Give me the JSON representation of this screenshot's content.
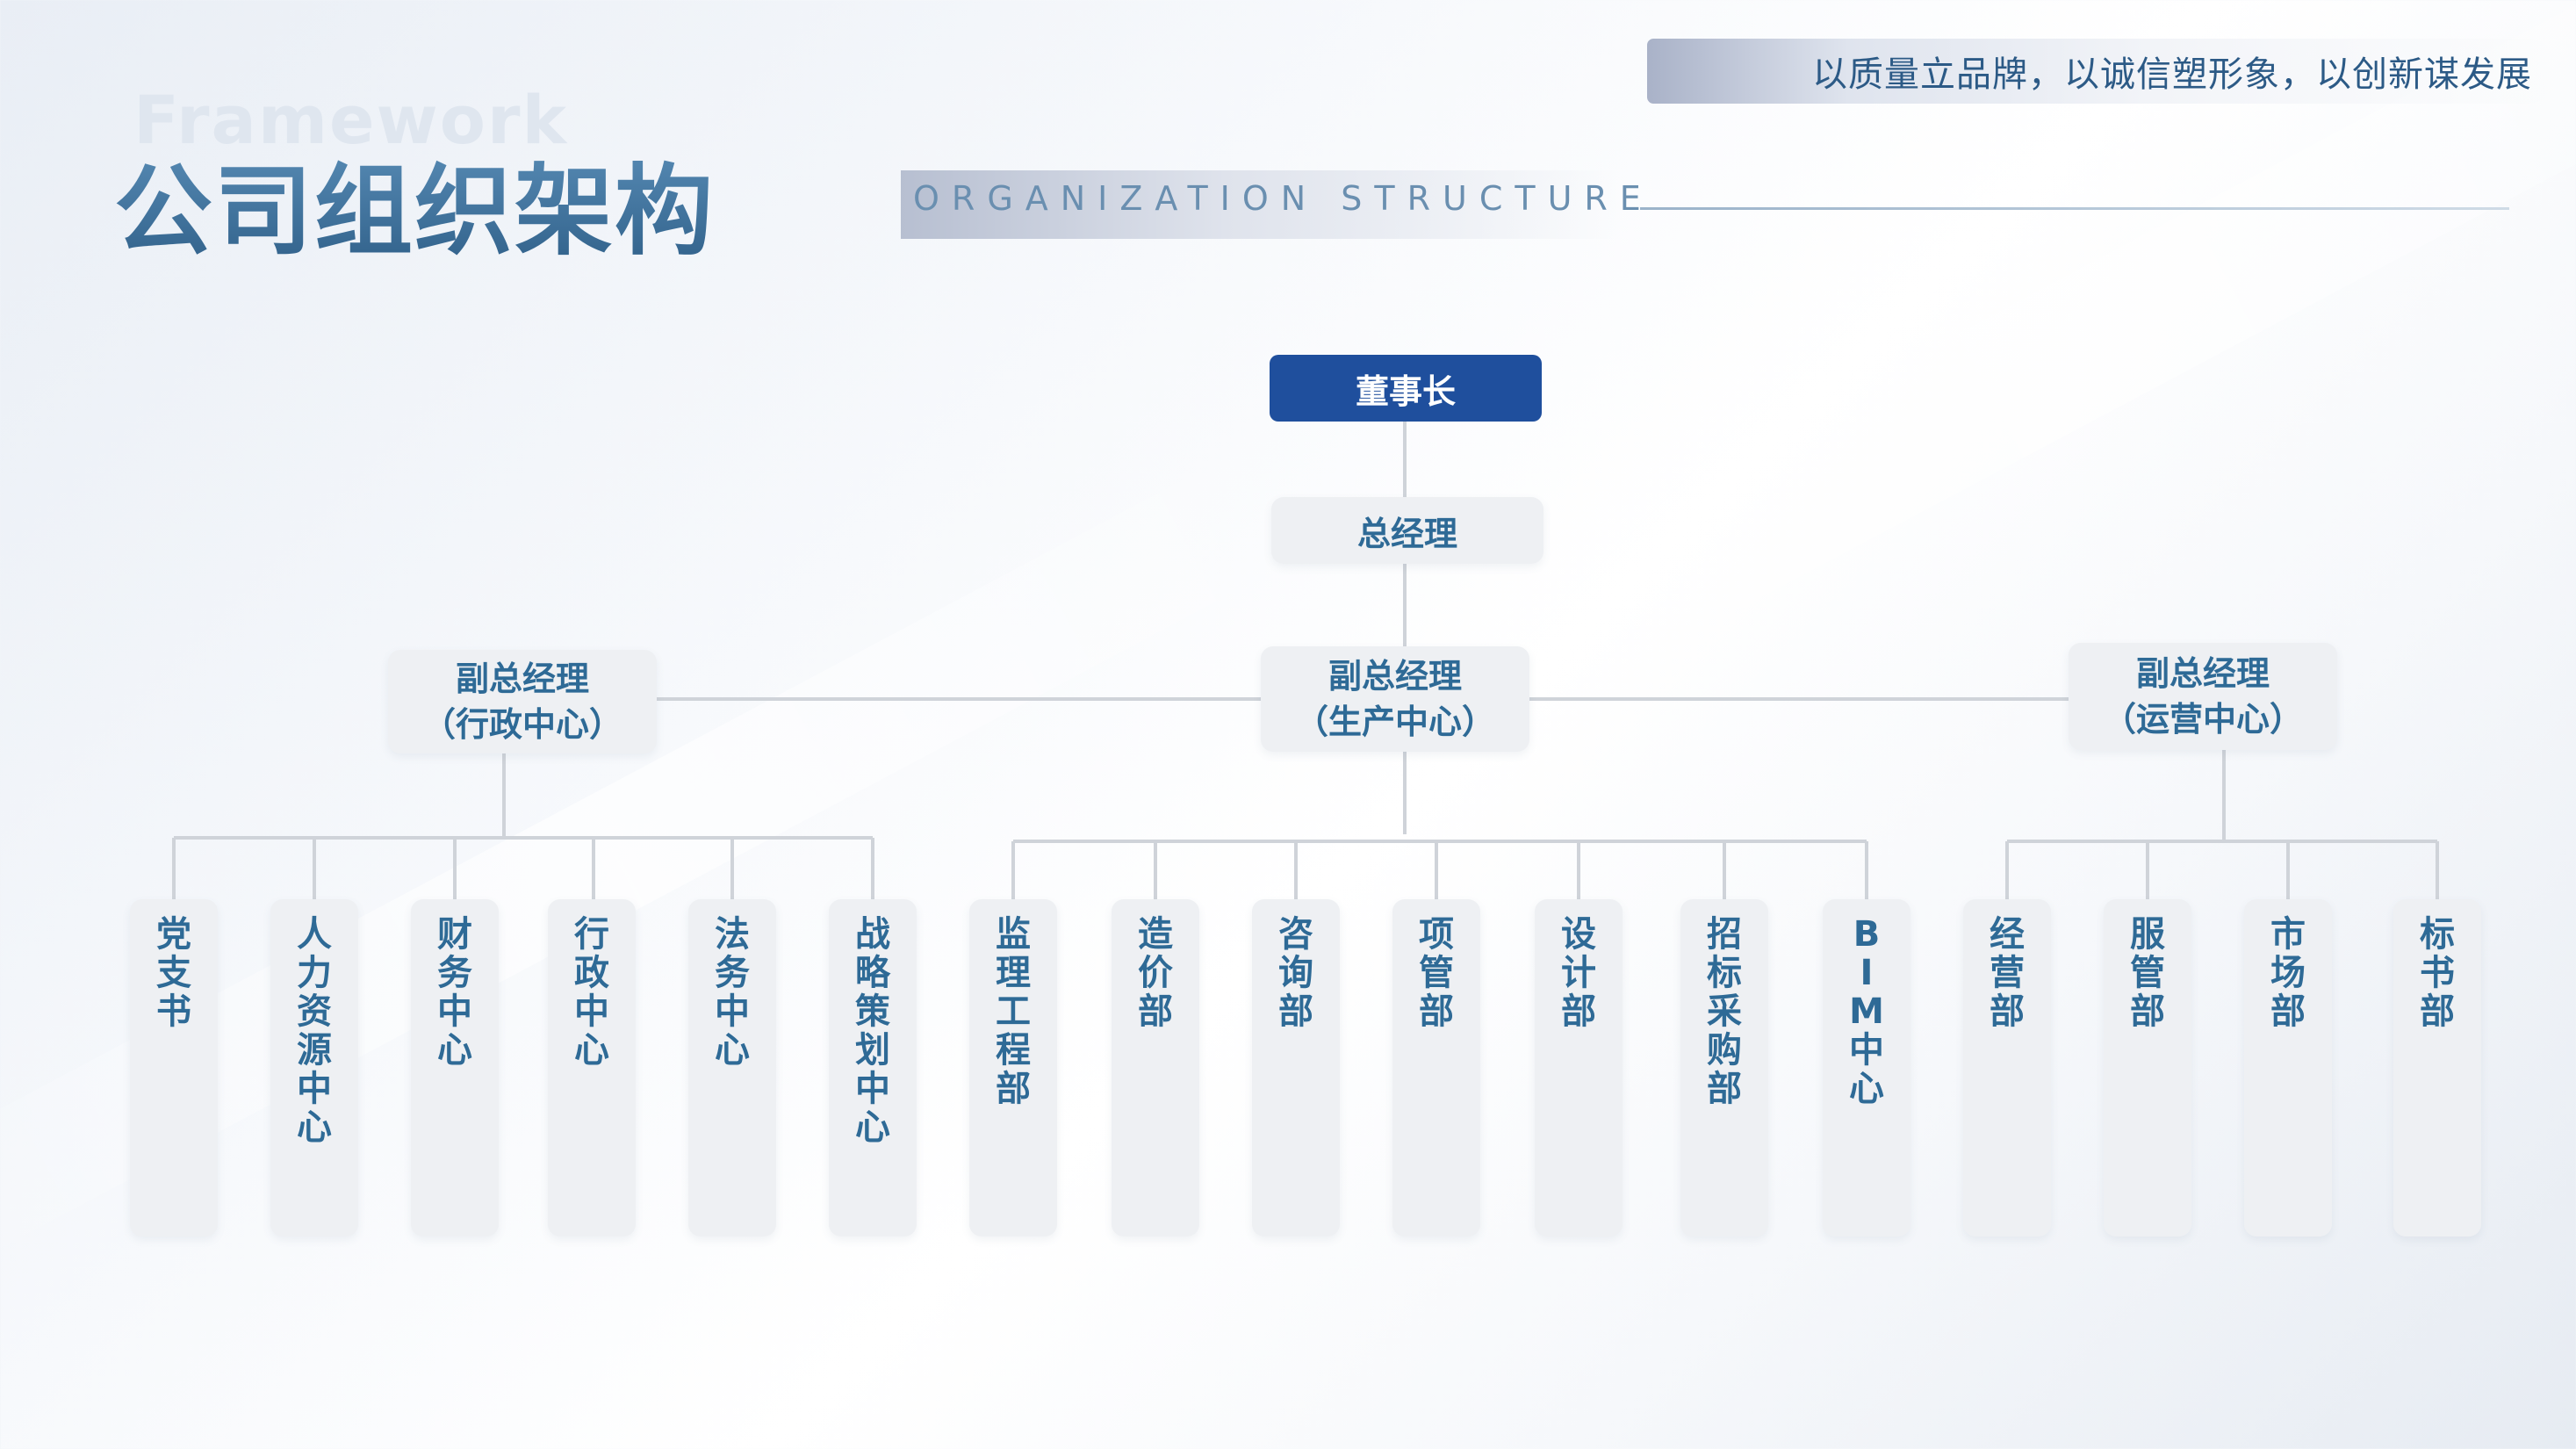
{
  "slogan": "以质量立品牌，以诚信塑形象，以创新谋发展",
  "title_watermark": "Framework",
  "title": "公司组织架构",
  "subtitle": "ORGANIZATION STRUCTURE",
  "org": {
    "chairman": "董事长",
    "general_manager": "总经理",
    "vp_admin": {
      "line1": "副总经理",
      "line2": "（行政中心）"
    },
    "vp_production": {
      "line1": "副总经理",
      "line2": "（生产中心）"
    },
    "vp_operations": {
      "line1": "副总经理",
      "line2": "（运营中心）"
    },
    "departments": [
      "党支书",
      "人力资源中心",
      "财务中心",
      "行政中心",
      "法务中心",
      "战略策划中心",
      "监理工程部",
      "造价部",
      "咨询部",
      "项管部",
      "设计部",
      "招标采购部",
      "BIM中心",
      "经营部",
      "服管部",
      "市场部",
      "标书部"
    ]
  },
  "colors": {
    "chairman_fill": "#1f4f9d",
    "node_fill": "#eef0f3",
    "node_text": "#2e6a96",
    "connector": "#cfd3d9"
  }
}
